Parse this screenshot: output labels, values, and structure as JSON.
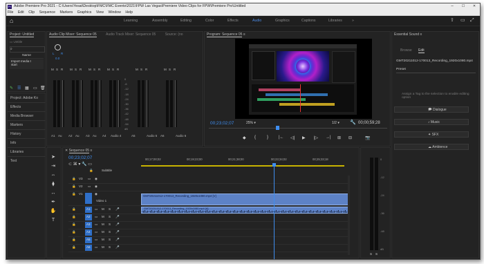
{
  "window": {
    "title": "Adobe Premiere Pro 2021 - C:\\Users\\Yesat\\Desktop\\FMC\\FMC Events\\2021\\FPW Las Vegas\\Premiere Video Clips for FPW\\Premiere Pro\\Untitled",
    "controls": {
      "minimize": "–",
      "maximize": "☐",
      "close": "✕"
    }
  },
  "menu": [
    "File",
    "Edit",
    "Clip",
    "Sequence",
    "Markers",
    "Graphics",
    "View",
    "Window",
    "Help"
  ],
  "workspaces": {
    "items": [
      "Learning",
      "Assembly",
      "Editing",
      "Color",
      "Effects",
      "Audio",
      "Graphics",
      "Captions",
      "Libraries"
    ],
    "active": "Audio"
  },
  "project": {
    "tab": "Project: Untitled",
    "subtab": "Untitle",
    "search_icon": "search-icon",
    "name_header": "Name",
    "item": "Import media t",
    "item2": "start",
    "lower_tab": "Project: Adobe Ko",
    "side_items": [
      "Effects",
      "Media Browser",
      "Markers",
      "History",
      "Info",
      "Libraries",
      "Text"
    ]
  },
  "mixer": {
    "tabs": [
      "Audio Clip Mixer: Sequence 05",
      "Audio Track Mixer: Sequence 05",
      "Source: (no"
    ],
    "lr": {
      "L": "L",
      "R": "R",
      "zero": "0.0"
    },
    "meter_scale": [
      "0",
      "-6",
      "-12",
      "-18",
      "-24",
      "-30",
      "-36",
      "-42",
      "-48",
      "-54",
      "dB"
    ],
    "channels": [
      "A1",
      "Audio 1",
      "A2",
      "Audio 2",
      "A3",
      "Audio 3",
      "A4",
      "Audio 4",
      "A5",
      "Audio 5",
      "A6",
      "Audio 6"
    ],
    "bottom_labels": {
      "a1": "A1",
      "au": "Au",
      "a2": "A2",
      "au2": "Au",
      "a3": "A3",
      "au3": "Au",
      "a4": "A4",
      "audio4": "Audio 4",
      "a5": "A5",
      "audio5": "Audio 5",
      "a6": "A6",
      "audio6": "Audio 6"
    },
    "buttons": {
      "mute": "M",
      "solo": "S",
      "rec": "R"
    }
  },
  "program": {
    "tab": "Program: Sequence 05",
    "timecode": "00;23;02;07",
    "zoom": "25%",
    "quality": "1/2",
    "duration": "00;00;59;28",
    "marker_icon": "marker-icon",
    "transport": [
      "{",
      "}",
      "|←",
      "◁|",
      "▶",
      "|▷",
      "→|",
      "⊞",
      "⊟",
      "📷",
      "+"
    ]
  },
  "essential_sound": {
    "tab": "Essential Sound",
    "subtabs": [
      "Browse",
      "Edit"
    ],
    "clip": "GMT20211012-170013_Recording_1920x1080.mp4",
    "preset_label": "Preset",
    "hint": "Assign a Tag to the selection to enable editing option",
    "tags": [
      "Dialogue",
      "Music",
      "SFX",
      "Ambience"
    ]
  },
  "timeline": {
    "tab": "Sequence 05",
    "timecode": "00;23;02;07",
    "ruler": [
      "00;17;00;02",
      "00;19;23;00",
      "00;21;38;00",
      "00;23;34;02",
      "00;25;33;18"
    ],
    "subtitle": "Subtitle",
    "video_tracks": [
      "V3",
      "V2",
      "V1"
    ],
    "video1_label": "Video 1",
    "audio_tracks": [
      "A1",
      "A2",
      "A3",
      "A4",
      "A5",
      "A6"
    ],
    "track_buttons": {
      "m": "M",
      "s": "S"
    },
    "video_clip": "GMT20211012-170013_Recording_1920x1080.mp4 [V]",
    "audio_clip": "GMT20211012-170013_Recording_1920x1080.mp4 [A]",
    "vu_scale": [
      "0",
      "-12",
      "-24",
      "-36",
      "-48",
      "dB"
    ],
    "vu_bottom": [
      "S",
      "S"
    ]
  },
  "colors": {
    "accent": "#3f8ef0",
    "clip_blue": "#5d82c6",
    "background": "#1d1d1d"
  }
}
